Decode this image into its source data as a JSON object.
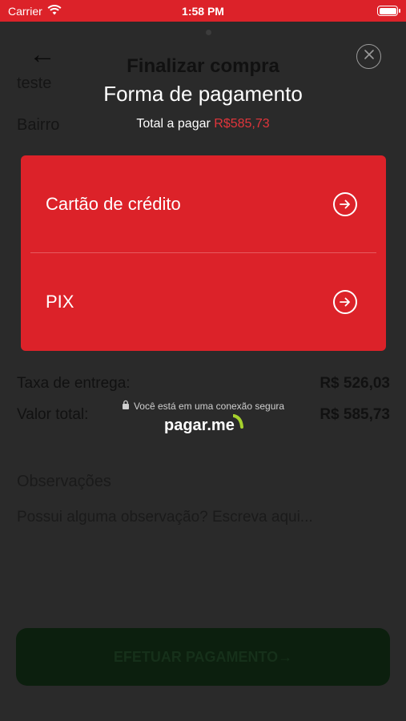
{
  "status_bar": {
    "carrier": "Carrier",
    "time": "1:58 PM"
  },
  "background": {
    "title": "Finalizar compra",
    "address_line": "teste",
    "neighborhood_placeholder": "Bairro",
    "delivery_fee_label": "Taxa de entrega:",
    "delivery_fee_value": "R$ 526,03",
    "total_label": "Valor total:",
    "total_value": "R$ 585,73",
    "notes_label": "Observações",
    "notes_placeholder": "Possui alguma observação? Escreva aqui...",
    "pay_button": "EFETUAR PAGAMENTO→"
  },
  "modal": {
    "title": "Forma de pagamento",
    "total_prefix": "Total a pagar",
    "total_amount": "R$585,73",
    "options": [
      {
        "label": "Cartão de crédito"
      },
      {
        "label": "PIX"
      }
    ],
    "secure_text": "Você está em uma conexão segura",
    "brand": "pagar.me"
  },
  "colors": {
    "accent_red": "#dc2229",
    "price_red": "#e0353b",
    "overlay_bg": "#2a2a2a"
  },
  "icons": [
    "wifi-icon",
    "battery-icon",
    "back-arrow-icon",
    "close-icon",
    "arrow-right-circle-icon",
    "lock-icon"
  ]
}
